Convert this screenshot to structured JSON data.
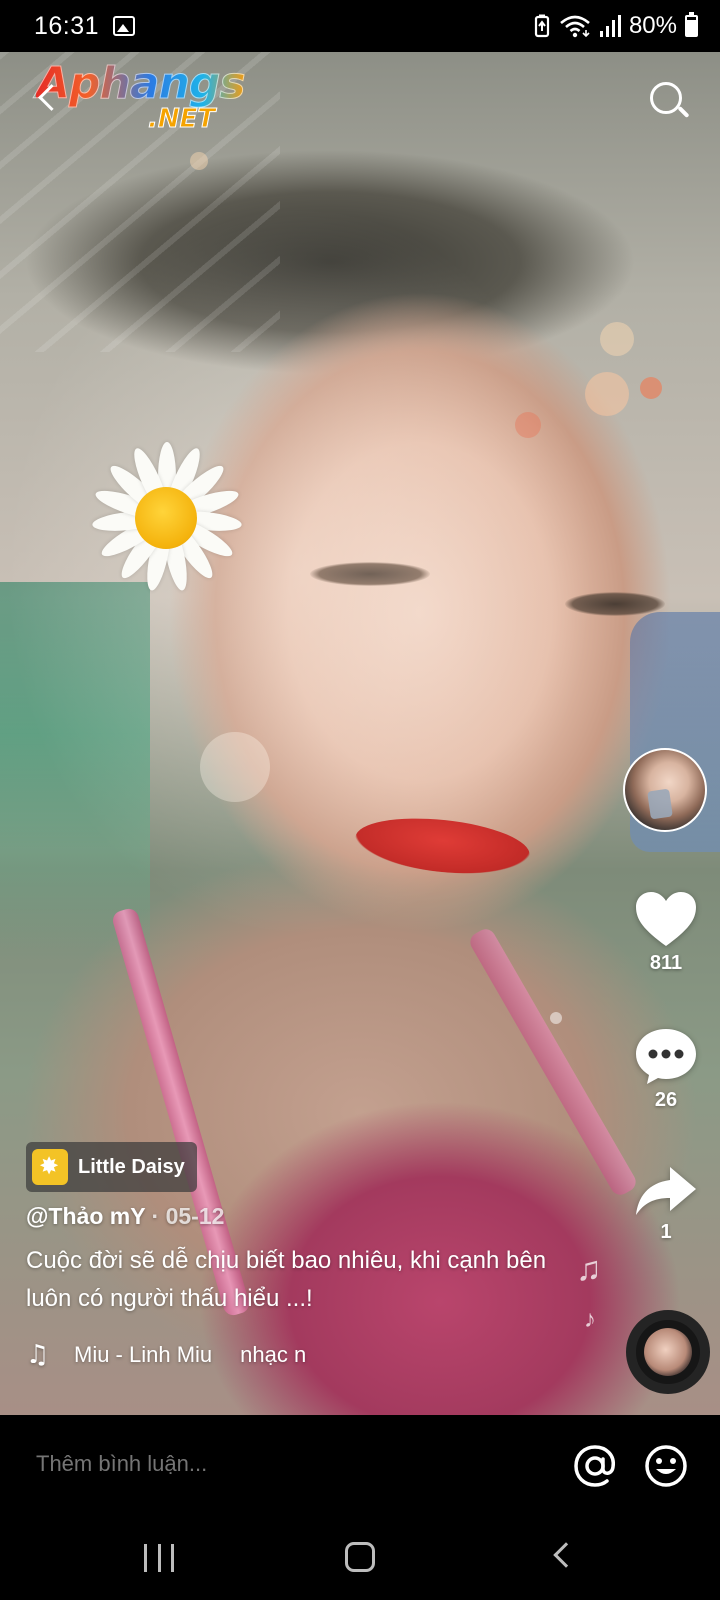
{
  "status_bar": {
    "time": "16:31",
    "battery_percent": "80%",
    "icons": [
      "gallery-icon",
      "battery-saver-icon",
      "wifi-icon",
      "signal-icon",
      "battery-icon"
    ]
  },
  "watermark": {
    "main": "Aphangs",
    "sub": ".NET"
  },
  "top_bar": {
    "back_icon": "back-arrow-icon",
    "search_icon": "search-icon"
  },
  "rail": {
    "likes": "811",
    "comments": "26",
    "shares": "1"
  },
  "video": {
    "effect_name": "Little Daisy",
    "author": "@Thảo mY",
    "date_separator": " · ",
    "date": "05-12",
    "caption": "Cuộc đời sẽ dễ chịu biết bao nhiêu, khi cạnh bên luôn có người thấu hiểu ...!",
    "music_note": "♫",
    "music_title": "Miu - Linh Miu",
    "music_title_scroll": "nhạc n"
  },
  "comment_bar": {
    "placeholder": "Thêm bình luận...",
    "mention_icon": "at-sign-icon",
    "emoji_icon": "emoji-icon"
  },
  "nav_bar": {
    "icons": [
      "recents-icon",
      "home-icon",
      "back-icon"
    ]
  },
  "colors": {
    "background": "#000000",
    "text": "#ffffff",
    "placeholder": "#7a7a7a",
    "effect_icon": "#f3c326"
  }
}
